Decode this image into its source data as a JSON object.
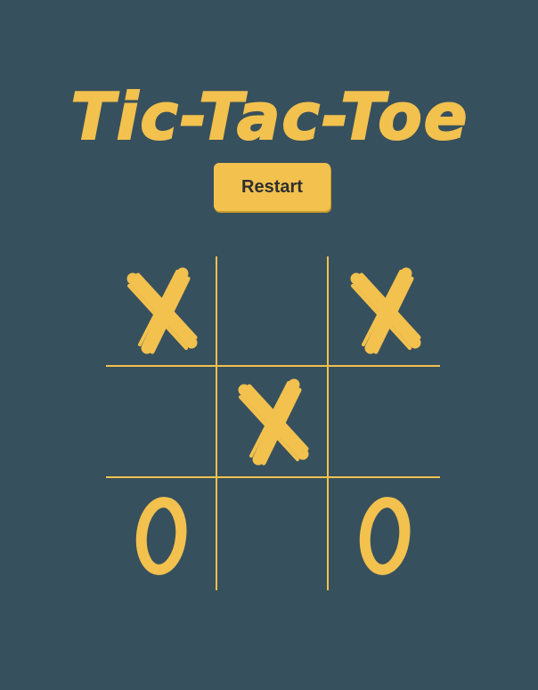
{
  "title": "Tic-Tac-Toe",
  "restart_label": "Restart",
  "colors": {
    "background": "#37505d",
    "accent": "#f2c14e",
    "button_text": "#2f2f2f"
  },
  "board": [
    [
      "X",
      "",
      "X"
    ],
    [
      "",
      "X",
      ""
    ],
    [
      "O",
      "",
      "O"
    ]
  ]
}
